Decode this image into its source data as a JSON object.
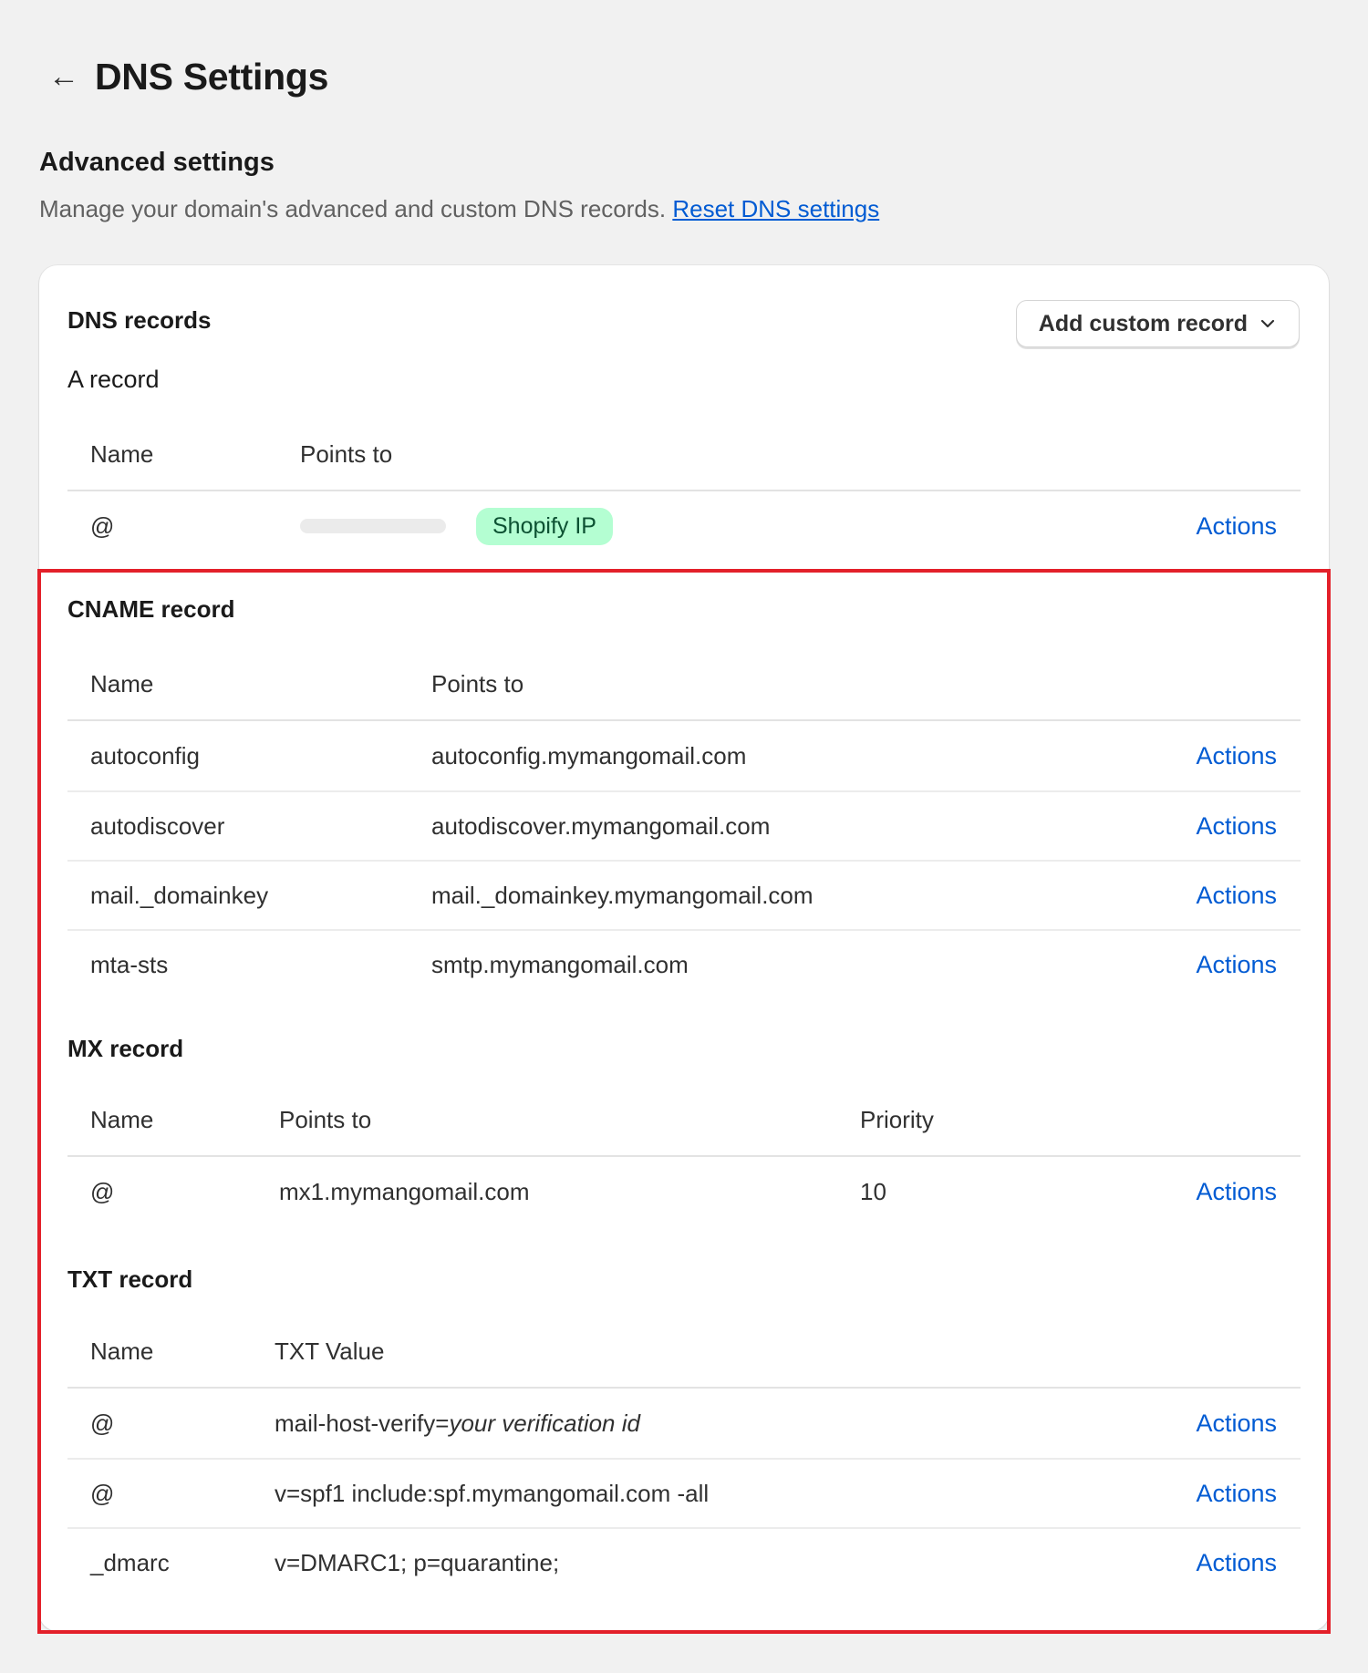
{
  "header": {
    "back_label": "←",
    "title": "DNS Settings"
  },
  "section": {
    "title": "Advanced settings",
    "description": "Manage your domain's advanced and custom DNS records.",
    "reset_link": "Reset DNS settings"
  },
  "card": {
    "title": "DNS records",
    "add_button": "Add custom record",
    "a_record": {
      "title": "A record",
      "headers": {
        "name": "Name",
        "points_to": "Points to"
      },
      "rows": [
        {
          "name": "@",
          "badge": "Shopify IP",
          "action": "Actions"
        }
      ]
    },
    "cname_record": {
      "title": "CNAME record",
      "headers": {
        "name": "Name",
        "points_to": "Points to"
      },
      "rows": [
        {
          "name": "autoconfig",
          "points_to": "autoconfig.mymangomail.com",
          "action": "Actions"
        },
        {
          "name": "autodiscover",
          "points_to": "autodiscover.mymangomail.com",
          "action": "Actions"
        },
        {
          "name": "mail._domainkey",
          "points_to": "mail._domainkey.mymangomail.com",
          "action": "Actions"
        },
        {
          "name": "mta-sts",
          "points_to": "smtp.mymangomail.com",
          "action": "Actions"
        }
      ]
    },
    "mx_record": {
      "title": "MX record",
      "headers": {
        "name": "Name",
        "points_to": "Points to",
        "priority": "Priority"
      },
      "rows": [
        {
          "name": "@",
          "points_to": "mx1.mymangomail.com",
          "priority": "10",
          "action": "Actions"
        }
      ]
    },
    "txt_record": {
      "title": "TXT record",
      "headers": {
        "name": "Name",
        "value": "TXT Value"
      },
      "rows": [
        {
          "name": "@",
          "value_prefix": "mail-host-verify=",
          "value_italic": "your verification id",
          "action": "Actions"
        },
        {
          "name": "@",
          "value": "v=spf1 include:spf.mymangomail.com -all",
          "action": "Actions"
        },
        {
          "name": "_dmarc",
          "value": "v=DMARC1; p=quarantine;",
          "action": "Actions"
        }
      ]
    }
  },
  "colors": {
    "link": "#005bd3",
    "badge_bg": "#b4fed2",
    "highlight": "#e3202a",
    "page_bg": "#f1f1f1"
  }
}
